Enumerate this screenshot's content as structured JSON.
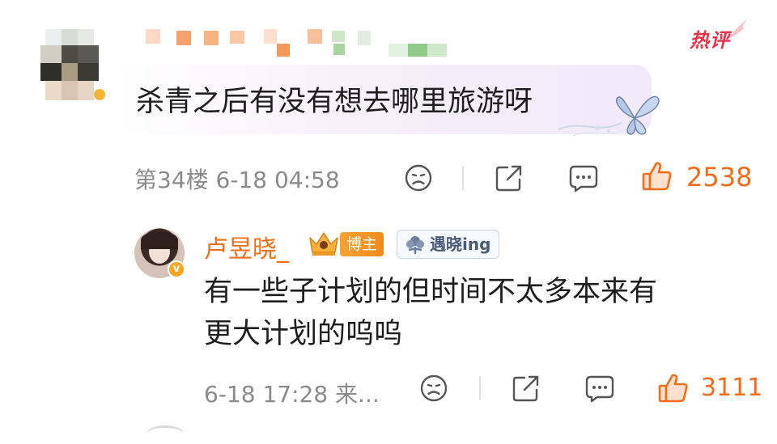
{
  "header": {
    "hot_label": "热评"
  },
  "comment": {
    "text": "杀青之后有没有想去哪里旅游呀",
    "floor": "第34楼",
    "time": "6-18 04:58",
    "like_count": "2538",
    "colors": {
      "like": "#f26c1a",
      "meta": "#8a8a8a"
    }
  },
  "reply": {
    "author": "卢昱晓_",
    "host_badge": "博主",
    "fan_badge": "遇晓ing",
    "text_line1": "有一些子计划的但时间不太多本来有",
    "text_line2": "更大计划的呜呜",
    "time_source": "6-18 17:28 来...",
    "like_count": "3111"
  },
  "icons": [
    "sad-face-icon",
    "share-icon",
    "reply-icon",
    "thumbs-up-icon",
    "butterfly-icon",
    "crown-icon",
    "verified-icon"
  ]
}
